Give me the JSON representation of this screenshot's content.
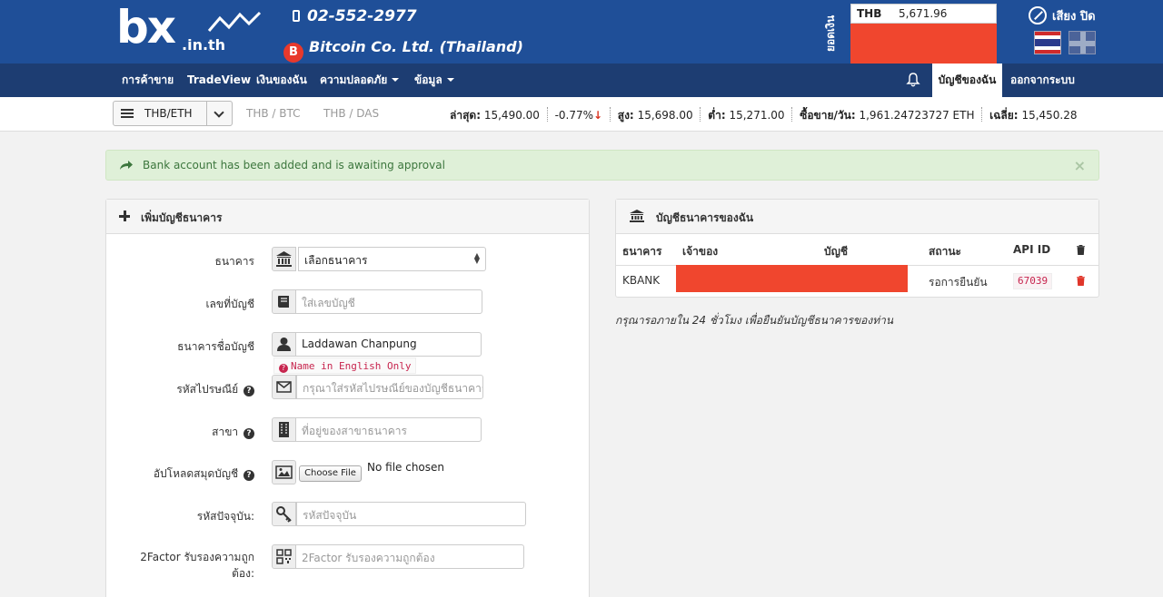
{
  "brand": {
    "logo_text": "bx",
    "logo_domain": ".in.th",
    "phone": "02-552-2977",
    "company": "Bitcoin Co. Ltd. (Thailand)"
  },
  "balance": {
    "label": "ยอดเงิน",
    "currency": "THB",
    "amount": "5,671.96"
  },
  "sound_label": "เสียง ปิด",
  "nav": {
    "items": [
      "การค้าขาย",
      "TradeView",
      "เงินของฉัน",
      "ความปลอดภัย",
      "ข้อมูล"
    ],
    "account": "บัญชีของฉัน",
    "logout": "ออกจากระบบ"
  },
  "pairs": {
    "selected": "THB/ETH",
    "others": [
      "THB / BTC",
      "THB / DAS"
    ]
  },
  "ticker": {
    "last_label": "ล่าสุด:",
    "last": "15,490.00",
    "change": "-0.77%",
    "high_label": "สูง:",
    "high": "15,698.00",
    "low_label": "ต่ำ:",
    "low": "15,271.00",
    "volume_label": "ซื้อขาย/วัน:",
    "volume": "1,961.24723727 ETH",
    "avg_label": "เฉลี่ย:",
    "avg": "15,450.28"
  },
  "alert": {
    "text": "Bank account has been added and is awaiting approval",
    "close": "×"
  },
  "add_panel": {
    "title": "เพิ่มบัญชีธนาคาร",
    "fields": {
      "bank": {
        "label": "ธนาคาร",
        "value": "เลือกธนาคาร"
      },
      "account_no": {
        "label": "เลขที่บัญชี",
        "placeholder": "ใส่เลขบัญชี"
      },
      "account_name": {
        "label": "ธนาคารชื่อบัญชี",
        "value": "Laddawan Chanpung",
        "error": "Name in English Only"
      },
      "postcode": {
        "label": "รหัสไปรษณีย์",
        "placeholder": "กรุณาใส่รหัสไปรษณีย์ของบัญชีธนาคาร"
      },
      "branch": {
        "label": "สาขา",
        "placeholder": "ที่อยู่ของสาขาธนาคาร"
      },
      "book_upload": {
        "label": "อัปโหลดสมุดบัญชี",
        "button": "Choose File",
        "status": "No file chosen"
      },
      "password": {
        "label": "รหัสปัจจุบัน:",
        "placeholder": "รหัสปัจจุบัน"
      },
      "twofactor": {
        "label": "2Factor รับรองความถูกต้อง:",
        "placeholder": "2Factor รับรองความถูกต้อง"
      }
    }
  },
  "accounts_panel": {
    "title": "บัญชีธนาคารของฉัน",
    "columns": [
      "ธนาคาร",
      "เจ้าของ",
      "บัญชี",
      "สถานะ",
      "API ID"
    ],
    "rows": [
      {
        "bank": "KBANK",
        "status": "รอการยืนยัน",
        "api_id": "67039"
      }
    ],
    "note": "กรุณารอภายใน 24 ชั่วโมง เพื่อยืนยันบัญชีธนาคารของท่าน"
  },
  "colors": {
    "header": "#1f4f98",
    "navbar": "#1d3d72",
    "redaction": "#f0462e",
    "alert_bg": "#dff0d8",
    "alert_text": "#3c763d"
  }
}
